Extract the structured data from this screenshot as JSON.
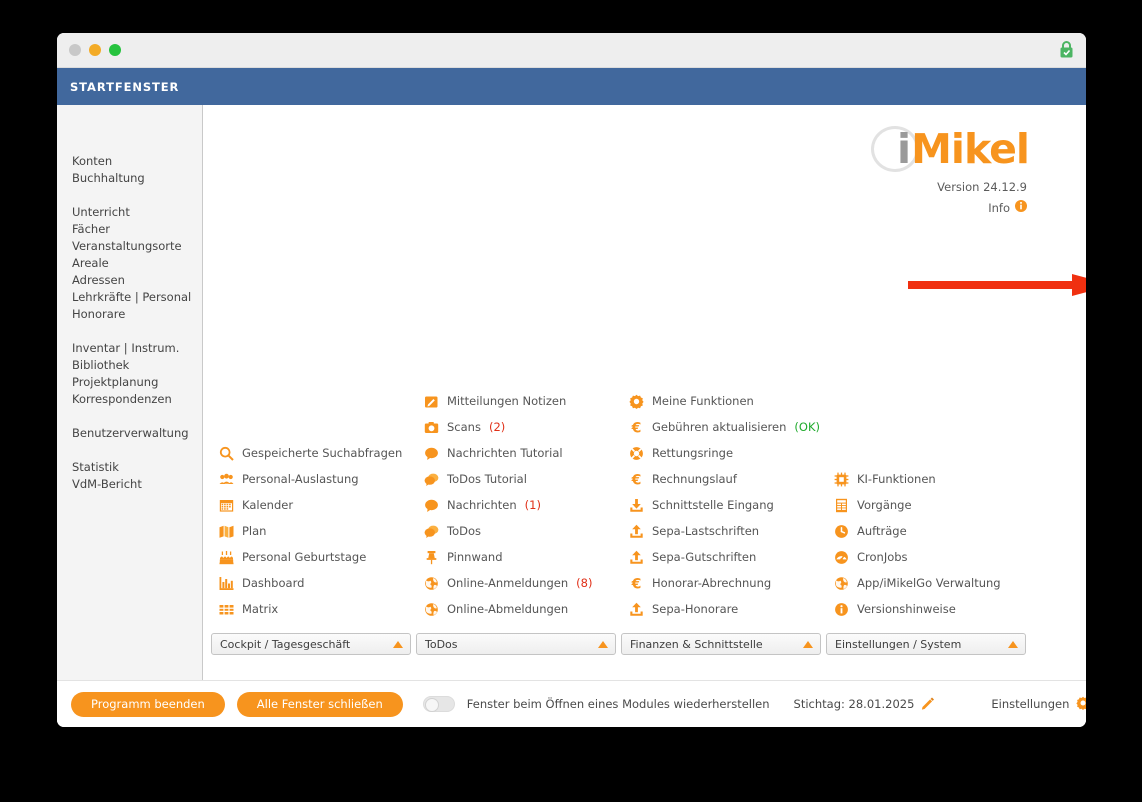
{
  "window": {
    "titlebar": {
      "close_label": "close",
      "minimize_label": "minimize",
      "maximize_label": "maximize",
      "lock_icon": "lock-secure-icon",
      "lock_color": "#4cb563"
    },
    "header": {
      "title": "STARTFENSTER",
      "bg": "#41689d"
    }
  },
  "sidebar": {
    "groups": [
      {
        "items": [
          "Konten",
          "Buchhaltung"
        ]
      },
      {
        "items": [
          "Unterricht",
          "Fächer",
          "Veranstaltungsorte",
          "Areale",
          "Adressen",
          "Lehrkräfte | Personal",
          "Honorare"
        ]
      },
      {
        "items": [
          "Inventar | Instrum.",
          "Bibliothek",
          "Projektplanung",
          "Korrespondenzen"
        ]
      },
      {
        "items": [
          "Benutzerverwaltung"
        ]
      },
      {
        "items": [
          "Statistik",
          "VdM-Bericht"
        ]
      }
    ]
  },
  "logo": {
    "letter_i": "i",
    "word": "Mikel",
    "version": "Version 24.12.9",
    "info_label": "Info",
    "info_icon": "info-circle-icon",
    "brand_color": "#f7941e",
    "i_color": "#9a9a9a"
  },
  "annotation": {
    "arrow_icon": "right-arrow-annotation",
    "color": "#f03010"
  },
  "grid": {
    "columns": [
      {
        "tab_label": "Cockpit / Tagesgeschäft",
        "items": [
          {
            "icon": "search-icon",
            "label": "Gespeicherte Suchabfragen"
          },
          {
            "icon": "users-icon",
            "label": "Personal-Auslastung"
          },
          {
            "icon": "calendar-icon",
            "label": "Kalender"
          },
          {
            "icon": "map-icon",
            "label": "Plan"
          },
          {
            "icon": "cake-icon",
            "label": "Personal Geburtstage"
          },
          {
            "icon": "bar-chart-icon",
            "label": "Dashboard"
          },
          {
            "icon": "grid-table-icon",
            "label": "Matrix"
          }
        ]
      },
      {
        "tab_label": "ToDos",
        "items": [
          {
            "icon": "pencil-square-icon",
            "label": "Mitteilungen Notizen"
          },
          {
            "icon": "camera-icon",
            "label": "Scans",
            "badge": "(2)",
            "badge_color": "red"
          },
          {
            "icon": "speech-bubble-icon",
            "label": "Nachrichten Tutorial"
          },
          {
            "icon": "double-bubble-icon",
            "label": "ToDos Tutorial"
          },
          {
            "icon": "speech-bubble-icon",
            "label": "Nachrichten",
            "badge": "(1)",
            "badge_color": "red"
          },
          {
            "icon": "double-bubble-icon",
            "label": "ToDos"
          },
          {
            "icon": "pin-icon",
            "label": "Pinnwand"
          },
          {
            "icon": "globe-icon",
            "label": "Online-Anmeldungen",
            "badge": "(8)",
            "badge_color": "red"
          },
          {
            "icon": "globe-icon",
            "label": "Online-Abmeldungen"
          }
        ]
      },
      {
        "tab_label": "Finanzen & Schnittstelle",
        "items": [
          {
            "icon": "gear-icon",
            "label": "Meine Funktionen"
          },
          {
            "icon": "euro-icon",
            "label": "Gebühren aktualisieren",
            "badge": "(OK)",
            "badge_color": "green"
          },
          {
            "icon": "lifebuoy-icon",
            "label": "Rettungsringe"
          },
          {
            "icon": "euro-icon",
            "label": "Rechnungslauf"
          },
          {
            "icon": "download-icon",
            "label": "Schnittstelle Eingang"
          },
          {
            "icon": "upload-icon",
            "label": "Sepa-Lastschriften"
          },
          {
            "icon": "upload-icon",
            "label": "Sepa-Gutschriften"
          },
          {
            "icon": "euro-icon",
            "label": "Honorar-Abrechnung"
          },
          {
            "icon": "upload-icon",
            "label": "Sepa-Honorare"
          }
        ]
      },
      {
        "tab_label": "Einstellungen / System",
        "items": [
          {
            "icon": "chip-icon",
            "label": "KI-Funktionen"
          },
          {
            "icon": "document-list-icon",
            "label": "Vorgänge"
          },
          {
            "icon": "clock-icon",
            "label": "Aufträge"
          },
          {
            "icon": "gauge-icon",
            "label": "CronJobs"
          },
          {
            "icon": "globe-icon",
            "label": "App/iMikelGo Verwaltung"
          },
          {
            "icon": "info-circle-icon",
            "label": "Versionshinweise"
          }
        ]
      }
    ]
  },
  "bottom": {
    "quit_label": "Programm beenden",
    "close_all_label": "Alle Fenster schließen",
    "toggle_on": false,
    "toggle_label": "Fenster beim Öffnen eines Modules wiederherstellen",
    "stichtag_label": "Stichtag: 28.01.2025",
    "stichtag_icon": "pencil-icon",
    "settings_label": "Einstellungen",
    "settings_icon": "gear-icon"
  }
}
